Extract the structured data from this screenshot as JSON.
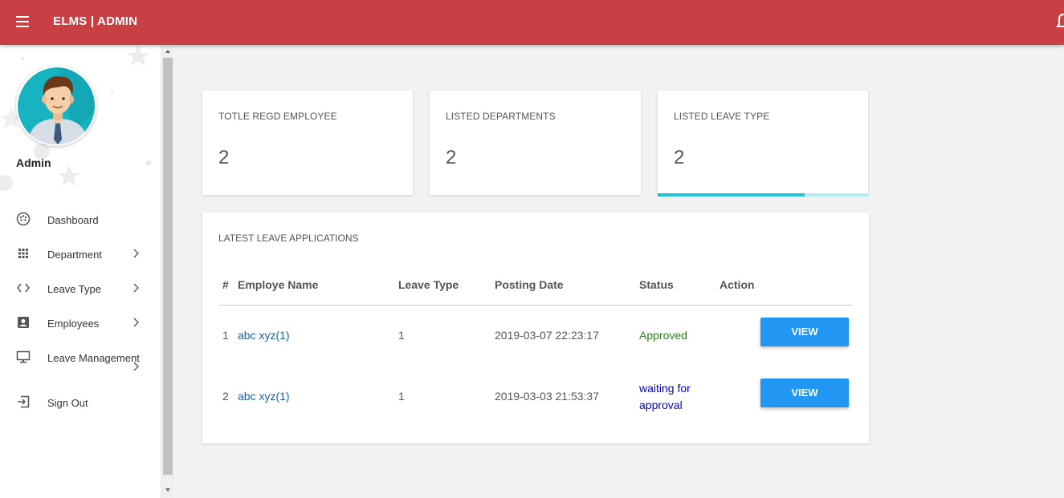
{
  "header": {
    "brand": "ELMS | ADMIN",
    "menu_icon": "hamburger-icon",
    "notification_icon": "bell-icon",
    "bg_color": "#c94044"
  },
  "profile": {
    "name": "Admin",
    "avatar_icon": "user-avatar"
  },
  "sidebar": {
    "items": [
      {
        "label": "Dashboard",
        "icon": "dashboard-icon"
      },
      {
        "label": "Department",
        "icon": "grid-icon"
      },
      {
        "label": "Leave Type",
        "icon": "code-icon"
      },
      {
        "label": "Employees",
        "icon": "account-box-icon"
      },
      {
        "label": "Leave Management",
        "icon": "desktop-icon"
      },
      {
        "label": "Sign Out",
        "icon": "logout-icon"
      }
    ]
  },
  "stats": [
    {
      "title": "TOTLE REGD EMPLOYEE",
      "value": "2"
    },
    {
      "title": "LISTED DEPARTMENTS",
      "value": "2"
    },
    {
      "title": "LISTED LEAVE TYPE",
      "value": "2",
      "progress": 0.7
    }
  ],
  "latest": {
    "title": "LATEST LEAVE APPLICATIONS",
    "columns": [
      "#",
      "Employe Name",
      "Leave Type",
      "Posting Date",
      "Status",
      "Action"
    ],
    "rows": [
      {
        "num": "1",
        "name": "abc xyz(1)",
        "leave_type": "1",
        "date": "2019-03-07 22:23:17",
        "status": "Approved",
        "action": "VIEW"
      },
      {
        "num": "2",
        "name": "abc xyz(1)",
        "leave_type": "1",
        "date": "2019-03-03 21:53:37",
        "status": "waiting for approval",
        "action": "VIEW"
      }
    ]
  },
  "colors": {
    "accent": "#2196f3",
    "approved": "#2e7d1f",
    "waiting": "#0000cc",
    "progress": "#26c6da"
  }
}
